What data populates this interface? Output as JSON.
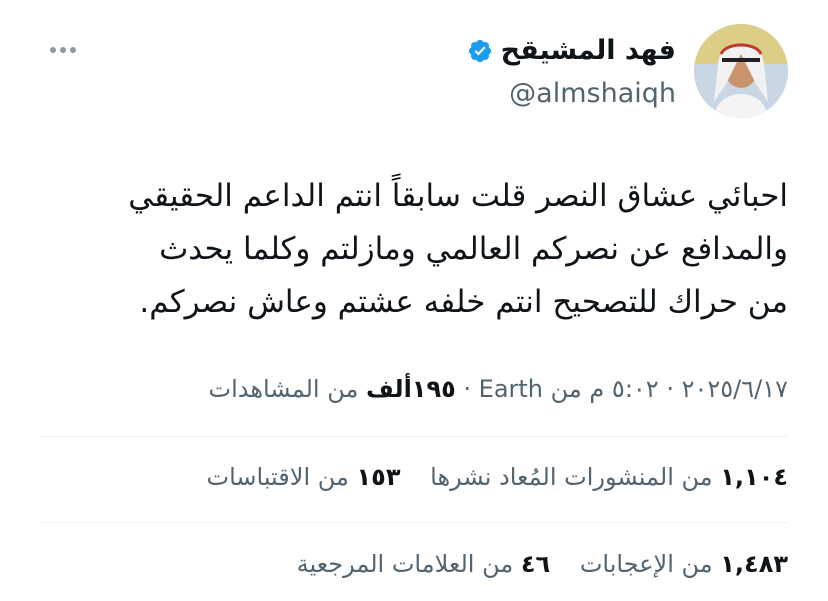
{
  "user": {
    "display_name": "فهد المشيقح",
    "handle": "@almshaiqh"
  },
  "tweet": {
    "text": "احبائي عشاق النصر  قلت سابقاً انتم الداعم الحقيقي\nوالمدافع عن نصركم العالمي  ومازلتم   وكلما يحدث\nمن حراك للتصحيح انتم خلفه عشتم وعاش نصركم."
  },
  "meta": {
    "date": "٢٠٢٥/٦/١٧",
    "time": "٥:٠٢ م",
    "source": "Earth",
    "views_count": "١٩٥ألف",
    "views_label": "من المشاهدات"
  },
  "stats": {
    "reposts_count": "١,١٠٤",
    "reposts_label": "من المنشورات المُعاد نشرها",
    "quotes_count": "١٥٣",
    "quotes_label": "من الاقتباسات",
    "likes_count": "١,٤٨٣",
    "likes_label": "من الإعجابات",
    "bookmarks_count": "٤٦",
    "bookmarks_label": "من العلامات المرجعية"
  },
  "colors": {
    "verified": "#1d9bf0",
    "secondary_text": "#536471",
    "primary_text": "#0f1419"
  },
  "icons": [
    "verified-badge-icon",
    "more-options-icon"
  ]
}
